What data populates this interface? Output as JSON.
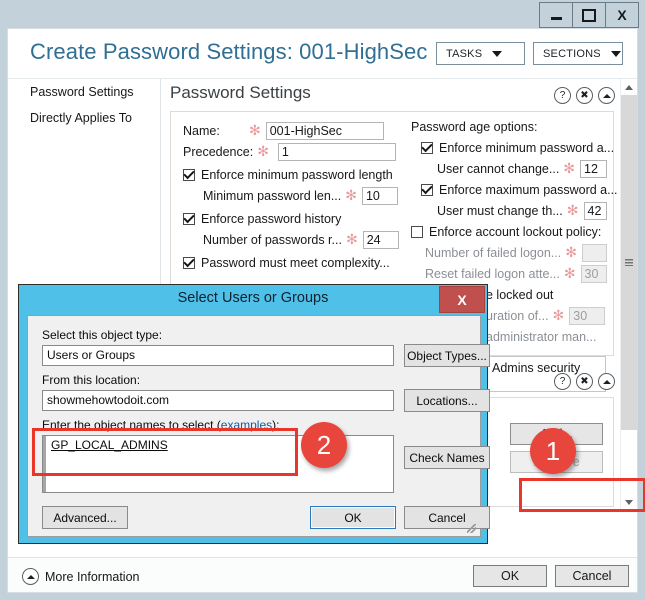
{
  "window": {
    "buttons": {
      "minimize": "minimize-icon",
      "maximize": "maximize-icon",
      "close": "X"
    }
  },
  "header": {
    "title": "Create Password Settings: 001-HighSec",
    "tasks_label": "TASKS",
    "sections_label": "SECTIONS"
  },
  "sidebar": {
    "items": [
      {
        "label": "Password Settings"
      },
      {
        "label": "Directly Applies To"
      }
    ]
  },
  "sections": {
    "password_settings": {
      "title": "Password Settings",
      "left": {
        "name_label": "Name:",
        "name_value": "001-HighSec",
        "precedence_label": "Precedence:",
        "precedence_value": "1",
        "cb_min_length": "Enforce minimum password length",
        "min_length_label": "Minimum password len...",
        "min_length_value": "10",
        "cb_history": "Enforce password history",
        "history_label": "Number of passwords r...",
        "history_value": "24",
        "cb_complexity": "Password must meet complexity..."
      },
      "right": {
        "group_label": "Password age options:",
        "cb_min_age": "Enforce minimum password a...",
        "min_age_label": "User cannot change...",
        "min_age_value": "12",
        "cb_max_age": "Enforce maximum password a...",
        "max_age_label": "User must change th...",
        "max_age_value": "42",
        "cb_lockout": "Enforce account lockout policy:",
        "failed_logon_label": "Number of failed logon...",
        "failed_logon_value": "",
        "reset_failed_label": "Reset failed logon atte...",
        "reset_failed_value": "30",
        "locked_out_label": "e locked out",
        "duration_label": "uration of...",
        "duration_value": "30",
        "admin_label": "administrator man...",
        "description_value": "Admins security"
      }
    },
    "directly_applies_to": {
      "add_label": "Add...",
      "remove_label": "Remove"
    }
  },
  "dialog": {
    "title": "Select Users or Groups",
    "close_label": "X",
    "object_type_label": "Select this object type:",
    "object_type_value": "Users or Groups",
    "object_types_button": "Object Types...",
    "location_label": "From this location:",
    "location_value": "showmehowtodoit.com",
    "locations_button": "Locations...",
    "names_label_pre": "Enter the object names to select (",
    "names_label_link": "examples",
    "names_label_post": "):",
    "names_value": "GP_LOCAL_ADMINS",
    "check_names_button": "Check Names",
    "advanced_button": "Advanced...",
    "ok_button": "OK",
    "cancel_button": "Cancel"
  },
  "footer": {
    "more_information": "More Information",
    "ok_label": "OK",
    "cancel_label": "Cancel"
  },
  "annotations": {
    "badge_1": "1",
    "badge_2": "2"
  },
  "colors": {
    "accent_blue": "#2f6f94",
    "dialog_frame": "#4fc0e8",
    "highlight_red": "#e8362a",
    "badge_red": "#e8453c",
    "required_asterisk": "#e99a9a",
    "window_bg": "#c3d2da"
  }
}
